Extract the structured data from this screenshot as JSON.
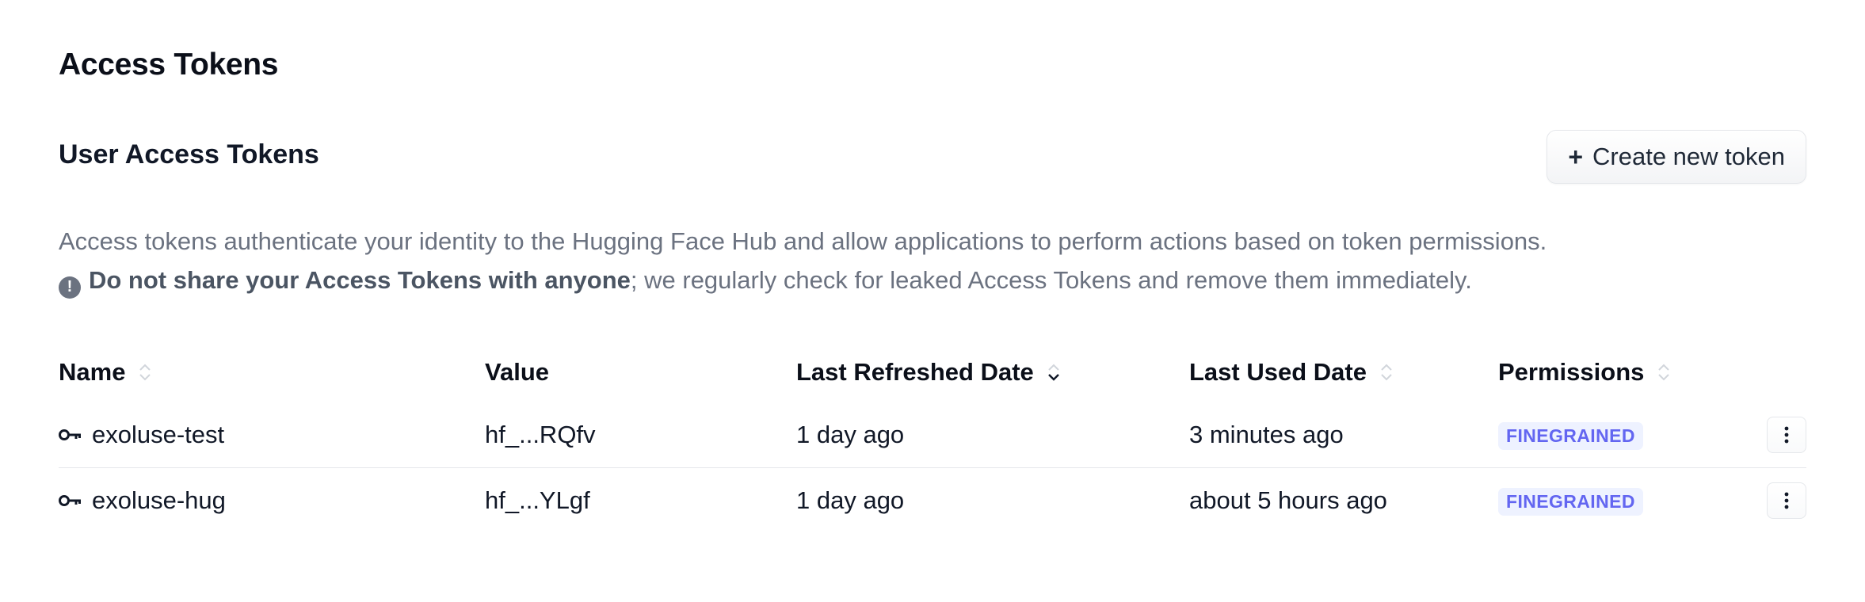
{
  "page_title": "Access Tokens",
  "section_title": "User Access Tokens",
  "create_button": {
    "plus": "+",
    "label": "Create new token"
  },
  "description": {
    "line1": "Access tokens authenticate your identity to the Hugging Face Hub and allow applications to perform actions based on token permissions.",
    "warn_prefix": "Do not share your ",
    "warn_bold": "Access Tokens",
    "warn_suffix_bold": " with anyone",
    "warn_rest": "; we regularly check for leaked Access Tokens and remove them immediately."
  },
  "table": {
    "headers": {
      "name": "Name",
      "value": "Value",
      "last_refreshed": "Last Refreshed Date",
      "last_used": "Last Used Date",
      "permissions": "Permissions"
    },
    "rows": [
      {
        "name": "exoluse-test",
        "value": "hf_...RQfv",
        "last_refreshed": "1 day ago",
        "last_used": "3 minutes ago",
        "permission": "FINEGRAINED"
      },
      {
        "name": "exoluse-hug",
        "value": "hf_...YLgf",
        "last_refreshed": "1 day ago",
        "last_used": "about 5 hours ago",
        "permission": "FINEGRAINED"
      }
    ]
  },
  "colors": {
    "badge_bg": "#eef2ff",
    "badge_text": "#6366f1",
    "muted_text": "#6b7280"
  },
  "icons": {
    "key": "key-icon",
    "sort": "sort-icon",
    "sort_active": "sort-desc-icon",
    "more": "more-vertical-icon",
    "warning": "exclamation-circle-icon"
  }
}
